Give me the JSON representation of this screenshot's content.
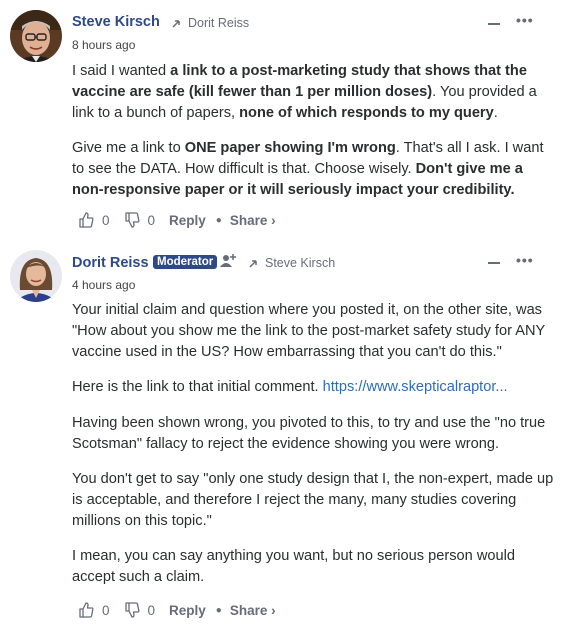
{
  "comments": [
    {
      "author": "Steve Kirsch",
      "reply_to": "Dorit Reiss",
      "time": "8 hours ago",
      "paragraphs": [
        [
          {
            "t": "I said I wanted ",
            "b": false
          },
          {
            "t": "a link to a post-marketing study that shows that the vaccine are safe (kill fewer than 1 per million doses)",
            "b": true
          },
          {
            "t": ". You provided a link to a bunch of papers, ",
            "b": false
          },
          {
            "t": "none of which responds to my query",
            "b": true
          },
          {
            "t": ".",
            "b": false
          }
        ],
        [
          {
            "t": "Give me a link to ",
            "b": false
          },
          {
            "t": "ONE paper showing I'm wrong",
            "b": true
          },
          {
            "t": ". That's all I ask. I want to see the DATA. How difficult is that. Choose wisely. ",
            "b": false
          },
          {
            "t": "Don't give me a non-responsive paper or it will seriously impact your credibility.",
            "b": true
          }
        ]
      ],
      "upvotes": "0",
      "downvotes": "0",
      "reply_label": "Reply",
      "share_label": "Share ›"
    },
    {
      "author": "Dorit Reiss",
      "badge": "Moderator",
      "reply_to": "Steve Kirsch",
      "time": "4 hours ago",
      "paragraphs": [
        [
          {
            "t": "Your initial claim and question where you posted it, on the other site, was \"How about you show me the link to the post-market safety study for ANY vaccine used in the US? How embarrassing that you can't do this.\"",
            "b": false
          }
        ],
        [
          {
            "t": "Here is the link to that initial comment. ",
            "b": false
          },
          {
            "t": "https://www.skepticalraptor...",
            "b": false,
            "link": true
          }
        ],
        [
          {
            "t": "Having been shown wrong, you pivoted to this, to try and use the \"no true Scotsman\" fallacy to reject the evidence showing you were wrong.",
            "b": false
          }
        ],
        [
          {
            "t": "You don't get to say \"only one study design that I, the non-expert, made up is acceptable, and therefore I reject the many, many studies covering millions on this topic.\"",
            "b": false
          }
        ],
        [
          {
            "t": "I mean, you can say anything you want, but no serious person would accept such a claim.",
            "b": false
          }
        ]
      ],
      "upvotes": "0",
      "downvotes": "0",
      "reply_label": "Reply",
      "share_label": "Share ›"
    }
  ],
  "icons": {
    "reply_to": "reply-arrow-icon",
    "upvote": "thumbs-up-icon",
    "downvote": "thumbs-down-icon",
    "collapse": "collapse-icon",
    "more": "more-options-icon",
    "follow": "follow-user-icon"
  },
  "colors": {
    "author": "#2e4a86",
    "badge_bg": "#2e4a86",
    "link": "#2e6cb8",
    "meta": "#656c7a"
  }
}
